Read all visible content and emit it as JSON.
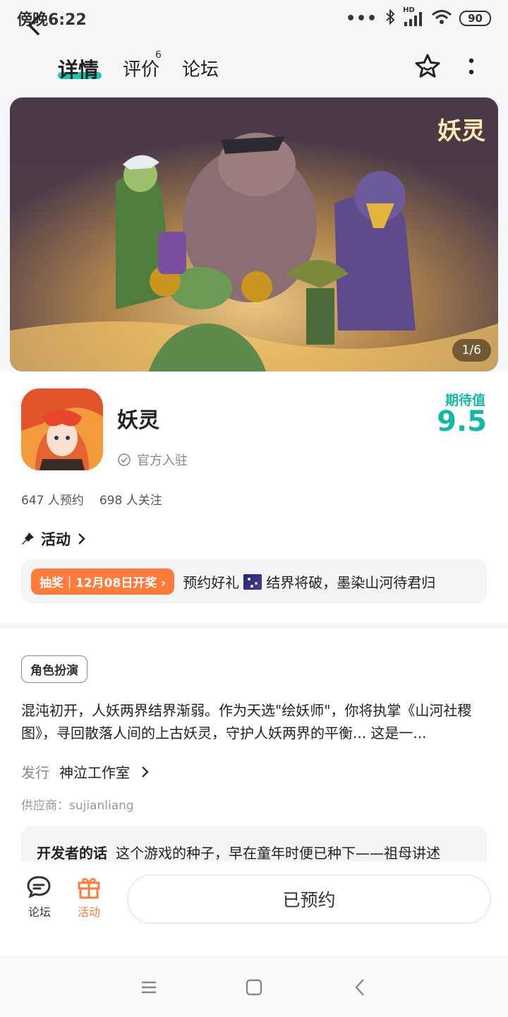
{
  "status_bar": {
    "time": "傍晚6:22",
    "bt_icon": "bluetooth-icon",
    "signal_label": "HD",
    "battery": "90"
  },
  "nav": {
    "tabs": [
      {
        "label": "详情",
        "active": true
      },
      {
        "label": "评价",
        "badge": "6"
      },
      {
        "label": "论坛"
      }
    ]
  },
  "banner": {
    "logo_text": "妖灵",
    "counter": "1/6"
  },
  "game": {
    "name": "妖灵",
    "official_label": "官方入驻",
    "expect_label": "期待值",
    "expect_value": "9.5",
    "reservations": "647 人预约",
    "followers": "698 人关注"
  },
  "activity": {
    "header": "活动",
    "badge": "抽奖｜12月08日开奖",
    "text_before": "预约好礼",
    "text_after": "结界将破，墨染山河待君归"
  },
  "details": {
    "tag": "角色扮演",
    "description": "混沌初开，人妖两界结界渐弱。作为天选\"绘妖师\"，你将执掌《山河社稷图》，寻回散落人间的上古妖灵，守护人妖两界的平衡... 这是一...",
    "publisher_label": "发行",
    "publisher": "神泣工作室",
    "supplier": "供应商：sujianliang",
    "dev_label": "开发者的话",
    "dev_text": "这个游戏的种子，早在童年时便已种下——祖母讲述"
  },
  "bottom_bar": {
    "forum_label": "论坛",
    "activity_label": "活动",
    "reserve_label": "已预约"
  },
  "colors": {
    "accent": "#14c8b5",
    "expect": "#14b8a6",
    "lottery": "#ff7b3b"
  }
}
